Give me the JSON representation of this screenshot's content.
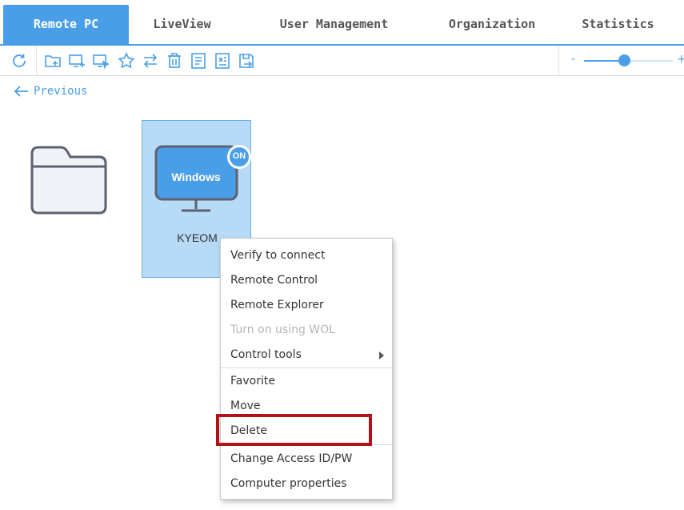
{
  "tabs": [
    {
      "label": "Remote PC",
      "active": true
    },
    {
      "label": "LiveView",
      "active": false
    },
    {
      "label": "User Management",
      "active": false
    },
    {
      "label": "Organization",
      "active": false
    },
    {
      "label": "Statistics",
      "active": false
    }
  ],
  "toolbar": {
    "icons": [
      "refresh-icon",
      "add-folder-icon",
      "add-computer-icon",
      "select-computer-icon",
      "favorite-star-icon",
      "swap-icon",
      "delete-computer-icon",
      "list-view-icon",
      "export-excel-icon",
      "save-export-icon"
    ],
    "zoom": {
      "minus": "-",
      "plus": "+",
      "level": 0.38
    }
  },
  "nav": {
    "previous_label": "Previous"
  },
  "items": {
    "folder": {
      "icon": "folder-icon"
    },
    "computer": {
      "os_label": "Windows",
      "status_badge": "ON",
      "name": "KYEOM"
    }
  },
  "context_menu": {
    "items": [
      {
        "label": "Verify to connect",
        "enabled": true
      },
      {
        "label": "Remote Control",
        "enabled": true
      },
      {
        "label": "Remote Explorer",
        "enabled": true
      },
      {
        "label": "Turn on using WOL",
        "enabled": false
      },
      {
        "label": "Control tools",
        "enabled": true,
        "submenu": true
      },
      {
        "label": "Favorite",
        "enabled": true
      },
      {
        "label": "Move",
        "enabled": true
      },
      {
        "label": "Delete",
        "enabled": true,
        "highlighted": true
      },
      {
        "label": "Change Access ID/PW",
        "enabled": true
      },
      {
        "label": "Computer properties",
        "enabled": true
      }
    ]
  },
  "colors": {
    "accent": "#4a9ee8",
    "selected_bg": "#b7daf7",
    "highlight_border": "#b01217",
    "disabled_text": "#b4b4b4"
  }
}
